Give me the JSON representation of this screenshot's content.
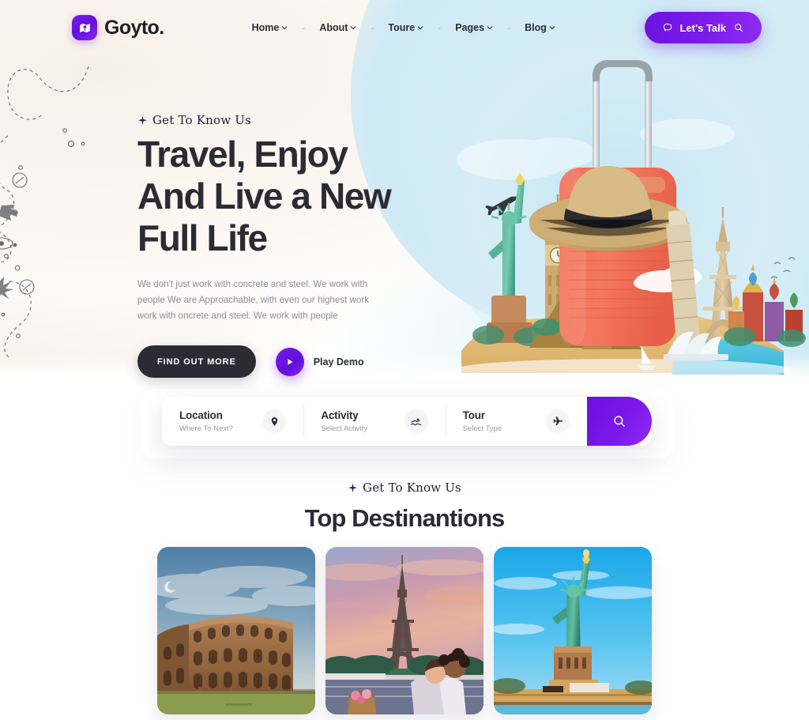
{
  "header": {
    "logo": {
      "text": "Goyto.",
      "icon": "map-location-icon",
      "accent": "#6d12e2"
    },
    "nav": [
      {
        "label": "Home",
        "has_dropdown": true
      },
      {
        "label": "About",
        "has_dropdown": true
      },
      {
        "label": "Toure",
        "has_dropdown": true
      },
      {
        "label": "Pages",
        "has_dropdown": true
      },
      {
        "label": "Blog",
        "has_dropdown": true
      }
    ],
    "nav_separator": "-",
    "cta": {
      "label": "Let's Talk",
      "left_icon": "chat-bubble-icon",
      "right_icon": "search-icon"
    }
  },
  "hero": {
    "eyebrow": "Get To Know Us",
    "eyebrow_icon": "sparkle-icon",
    "headline_lines": [
      "Travel, Enjoy",
      "And Live a New",
      "Full Life"
    ],
    "body": "We don't just work with concrete and steel. We work with people We are Approachable, with even our highest work work with oncrete and steel. We work with people",
    "primary_button": "FIND OUT MORE",
    "demo_label": "Play Demo",
    "demo_icon": "play-icon",
    "collage_alt": "Travel collage: coral suitcase, straw hat, Statue of Liberty, Big Ben, Pyramids, Leaning Tower of Pisa, Eiffel Tower, St. Basil's Cathedral, Sydney Opera House, airplane"
  },
  "search": {
    "fields": [
      {
        "title": "Location",
        "placeholder": "Where To Next?",
        "icon": "map-pin-icon"
      },
      {
        "title": "Activity",
        "placeholder": "Select Activity",
        "icon": "swimmer-icon"
      },
      {
        "title": "Tour",
        "placeholder": "Select Type",
        "icon": "airplane-icon"
      }
    ],
    "submit_icon": "search-icon",
    "accent": "#7a18ea"
  },
  "destinations": {
    "eyebrow": "Get To Know Us",
    "eyebrow_icon": "sparkle-icon",
    "title": "Top Destinantions",
    "cards": [
      {
        "name": "Colosseum, Rome"
      },
      {
        "name": "Eiffel Tower, Paris"
      },
      {
        "name": "Statue of Liberty, New York"
      }
    ]
  },
  "colors": {
    "brand_purple": "#6d12e2",
    "ink": "#2c2b33",
    "muted": "#8d8c96",
    "hero_bg_left": "#f6efe7",
    "hero_bg_right": "#cfeaf4",
    "suitcase": "#f3705a"
  }
}
